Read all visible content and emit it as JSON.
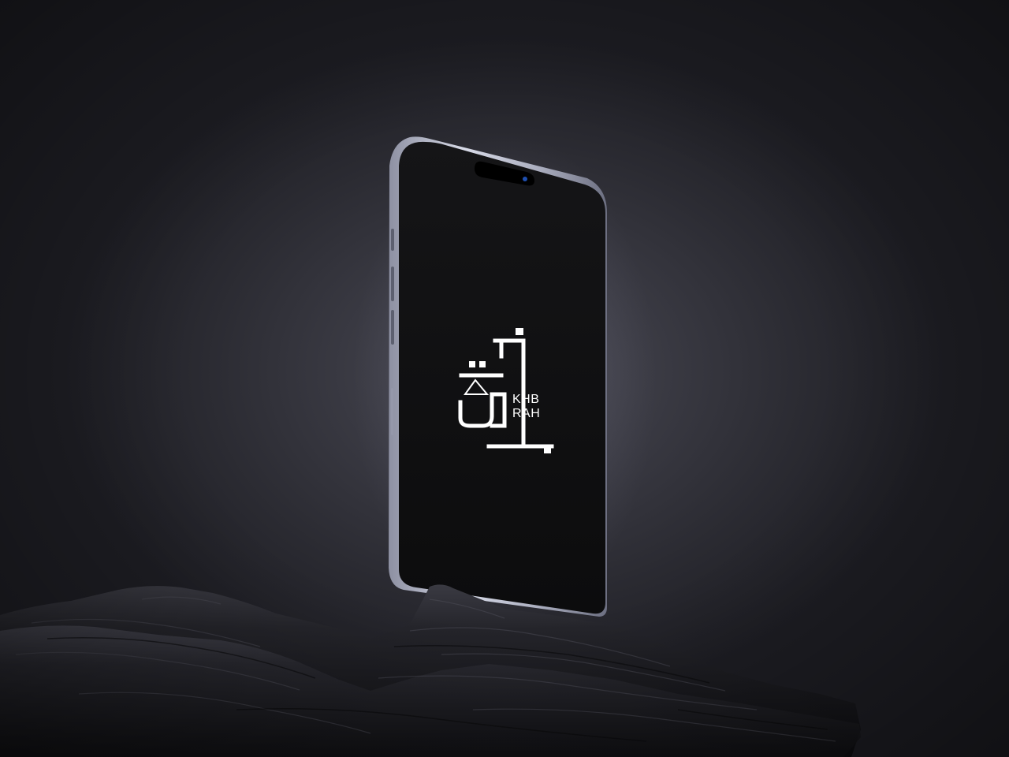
{
  "scene": {
    "background_color": "#2e2e36",
    "rock_color": "#1f1f24"
  },
  "device": {
    "type": "smartphone",
    "frame_color": "#b9bccc",
    "screen_color": "#0f0f10",
    "camera_lens_color": "#1f4fb0"
  },
  "logo": {
    "latin_line_1": "KHB",
    "latin_line_2": "RAH",
    "color": "#ffffff"
  }
}
